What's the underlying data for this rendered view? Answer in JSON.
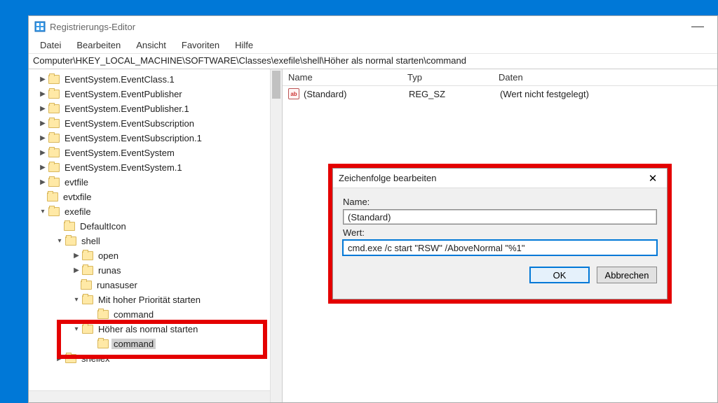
{
  "window": {
    "title": "Registrierungs-Editor"
  },
  "menu": {
    "file": "Datei",
    "edit": "Bearbeiten",
    "view": "Ansicht",
    "favorites": "Favoriten",
    "help": "Hilfe"
  },
  "address": "Computer\\HKEY_LOCAL_MACHINE\\SOFTWARE\\Classes\\exefile\\shell\\Höher als normal starten\\command",
  "tree": {
    "n0": "EventSystem.EventClass.1",
    "n1": "EventSystem.EventPublisher",
    "n2": "EventSystem.EventPublisher.1",
    "n3": "EventSystem.EventSubscription",
    "n4": "EventSystem.EventSubscription.1",
    "n5": "EventSystem.EventSystem",
    "n6": "EventSystem.EventSystem.1",
    "n7": "evtfile",
    "n8": "evtxfile",
    "n9": "exefile",
    "n9a": "DefaultIcon",
    "n9b": "shell",
    "n9b1": "open",
    "n9b2": "runas",
    "n9b3": "runasuser",
    "n9b4": "Mit hoher Priorität starten",
    "n9b4a": "command",
    "n9b5": "Höher als normal starten",
    "n9b5a": "command",
    "n9c": "shellex"
  },
  "list": {
    "col_name": "Name",
    "col_type": "Typ",
    "col_data": "Daten",
    "row0": {
      "name": "(Standard)",
      "type": "REG_SZ",
      "data": "(Wert nicht festgelegt)",
      "icon": "ab"
    }
  },
  "dialog": {
    "title": "Zeichenfolge bearbeiten",
    "name_label": "Name:",
    "name_value": "(Standard)",
    "value_label": "Wert:",
    "value_value": "cmd.exe /c start \"RSW\" /AboveNormal \"%1\"",
    "ok": "OK",
    "cancel": "Abbrechen"
  }
}
